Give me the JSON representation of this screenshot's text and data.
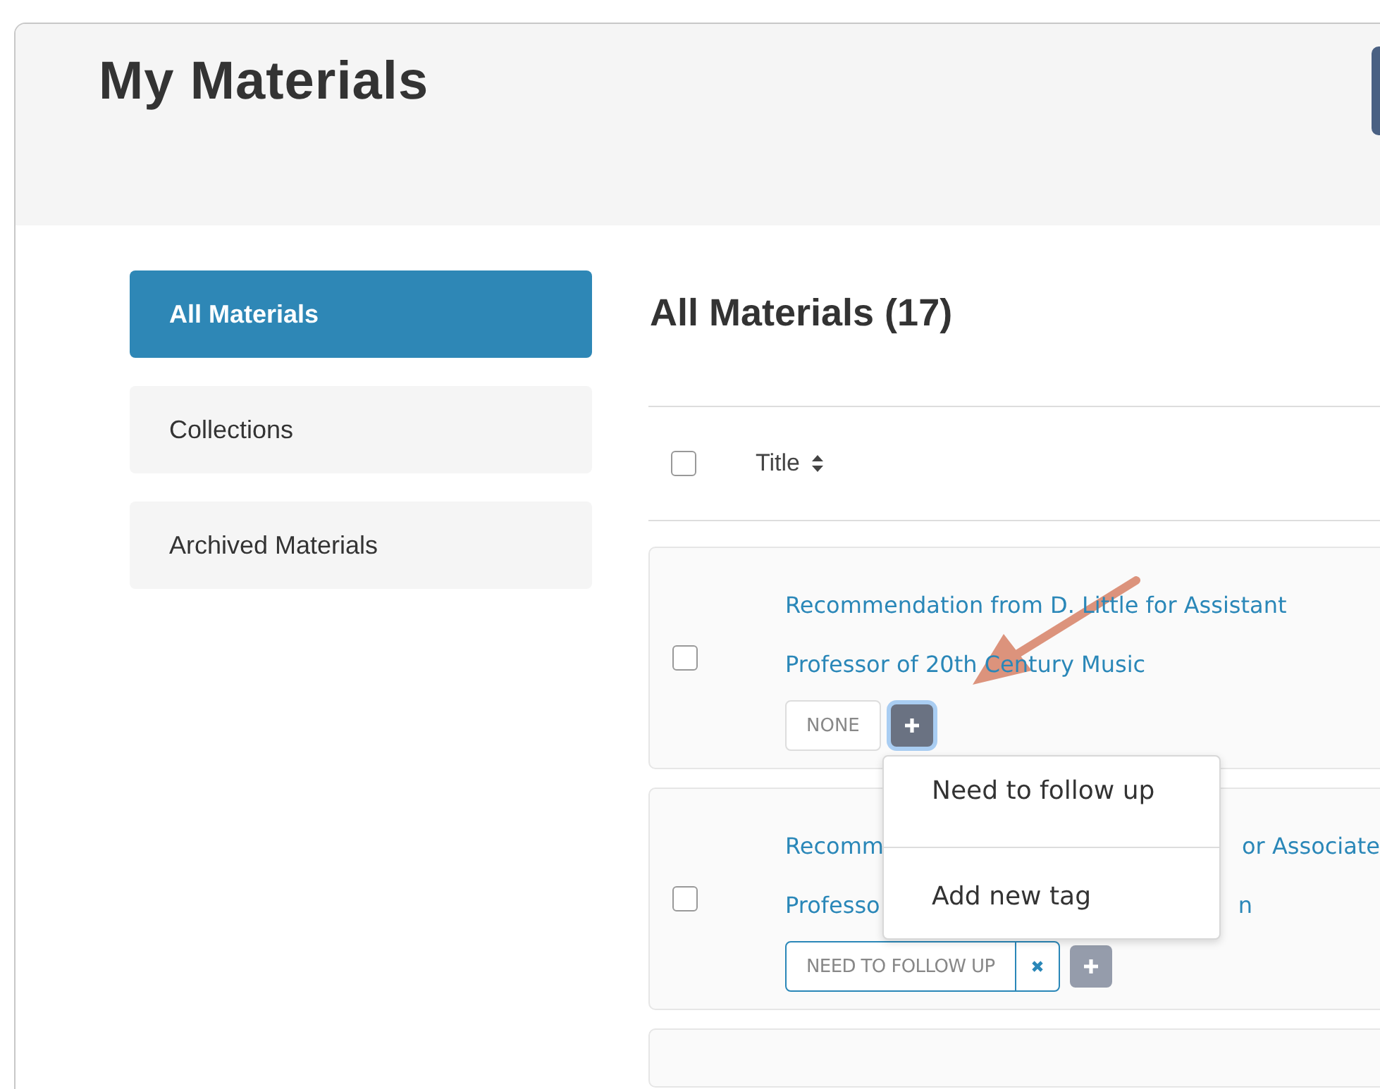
{
  "header": {
    "title": "My Materials"
  },
  "sidebar": {
    "items": [
      {
        "label": "All Materials",
        "selected": true
      },
      {
        "label": "Collections",
        "selected": false
      },
      {
        "label": "Archived Materials",
        "selected": false
      }
    ]
  },
  "main": {
    "heading": "All Materials (17)",
    "table": {
      "select_all_checked": false,
      "columns": [
        {
          "label": "Title"
        }
      ],
      "rows": [
        {
          "checked": false,
          "title_lines": [
            [
              "Recommendation from D. Little for Assistant"
            ],
            [
              "Professor of 20th Century Music"
            ]
          ],
          "tag": {
            "kind": "empty",
            "label": "NONE"
          },
          "add_active": true
        },
        {
          "checked": false,
          "title_lines": [
            [
              "Recomm",
              "or Associate"
            ],
            [
              "Professo",
              "n"
            ]
          ],
          "tag": {
            "kind": "applied",
            "label": "NEED TO FOLLOW UP"
          },
          "add_active": false
        }
      ]
    },
    "tag_menu": {
      "items": [
        "Need to follow up",
        "Add new tag"
      ]
    }
  }
}
